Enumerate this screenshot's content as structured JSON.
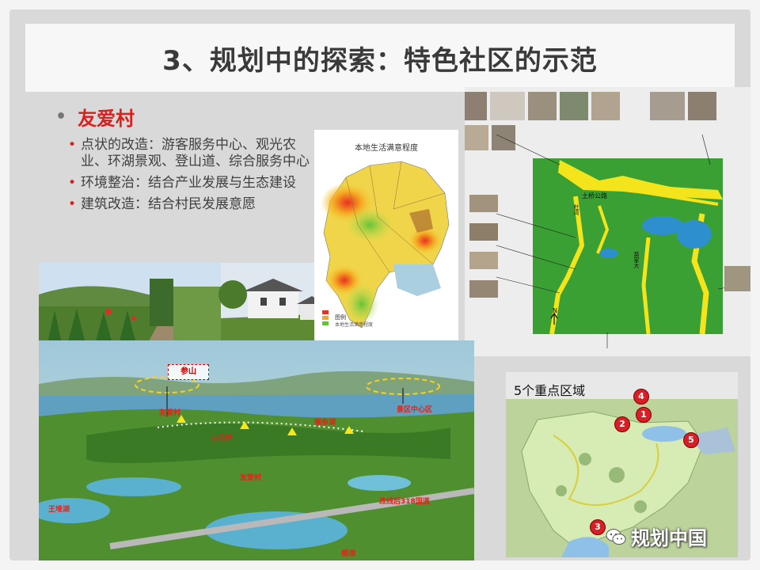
{
  "title": "3、规划中的探索：特色社区的示范",
  "bullets": {
    "main": "友爱村",
    "items": [
      "点状的改造：游客服务中心、观光农业、环湖景观、登山道、综合服务中心",
      "环境整治：结合产业发展与生态建设",
      "建筑改造：结合村民发展意愿"
    ]
  },
  "satisfaction_map": {
    "title": "本地生活满意程度",
    "legend_title": "图例",
    "legend_sub": "本地生活满意程度"
  },
  "aerial": {
    "labels": [
      "参山",
      "友爱村",
      "景区中心区",
      "三岗岭",
      "喉参湖",
      "友爱村",
      "王堆湖",
      "改线后318国道",
      "桐湖"
    ]
  },
  "plan": {
    "road": "土桥公路",
    "north": "N",
    "labels": [
      "杜湾",
      "英家大"
    ]
  },
  "key_zones": {
    "title": "5个重点区域",
    "markers": [
      "4",
      "1",
      "2",
      "5",
      "3"
    ],
    "watermark": "规划中国"
  },
  "colors": {
    "title_text": "#3a3a3a",
    "accent_red": "#d8211e",
    "plan_green": "#3aa033",
    "plan_yellow": "#f3e41b"
  }
}
